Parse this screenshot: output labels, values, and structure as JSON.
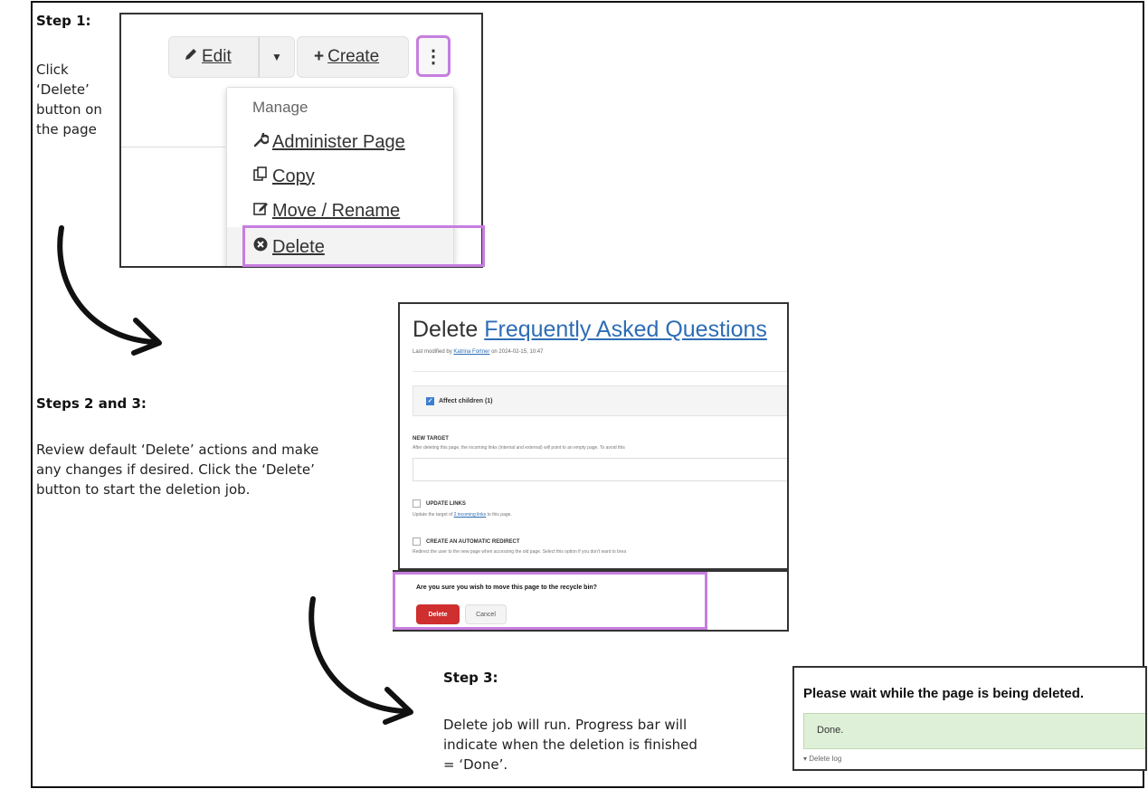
{
  "step1": {
    "heading": "Step 1:",
    "instructions": [
      "Click",
      "‘Delete’",
      "button on",
      "the page"
    ]
  },
  "toolbar": {
    "edit_label": "Edit",
    "create_label": "Create",
    "more_icon": "vertical-ellipsis-icon"
  },
  "menu": {
    "header": "Manage",
    "items": [
      {
        "label": "Administer Page",
        "icon": "wrench-icon"
      },
      {
        "label": "Copy",
        "icon": "copy-icon"
      },
      {
        "label": "Move / Rename",
        "icon": "edit-icon"
      },
      {
        "label": "Delete",
        "icon": "circle-x-icon"
      }
    ]
  },
  "step2": {
    "heading": "Steps 2 and 3:",
    "lines": [
      "Review default ‘Delete’ actions and make",
      "any changes if desired. Click the ‘Delete’",
      "button to start the deletion job."
    ]
  },
  "delete_page": {
    "title_prefix": "Delete",
    "title_link": "Frequently Asked Questions",
    "meta_prefix": "Last modified by",
    "meta_author": "Katrina Fortner",
    "meta_suffix": "on 2024-02-15, 10:47",
    "affect_children": "Affect children (1)",
    "new_target_heading": "NEW TARGET",
    "new_target_text": "After deleting this page, the incoming links (internal and external) will point to an empty page. To avoid this",
    "update_links_heading": "UPDATE LINKS",
    "update_links_prefix": "Update the target of",
    "update_links_link": "2 incoming links",
    "update_links_suffix": "to this page.",
    "redirect_heading": "CREATE AN AUTOMATIC REDIRECT",
    "redirect_text": "Redirect the user to the new page when accessing the old page. Select this option if you don't want to brea",
    "confirm_text": "Are you sure you wish to move this page to the recycle bin?",
    "delete_button": "Delete",
    "cancel_button": "Cancel"
  },
  "step3": {
    "heading": "Step 3:",
    "lines": [
      "Delete job will run. Progress bar will",
      "indicate when the deletion is finished",
      "= ‘Done’."
    ]
  },
  "progress": {
    "title": "Please wait while the page is being deleted.",
    "status": "Done.",
    "percent": 100,
    "log_label": "Delete log"
  },
  "colors": {
    "highlight": "#c77ee0",
    "link": "#2d6db5",
    "danger": "#cf2f2f",
    "success_bg": "#dff0d8"
  }
}
